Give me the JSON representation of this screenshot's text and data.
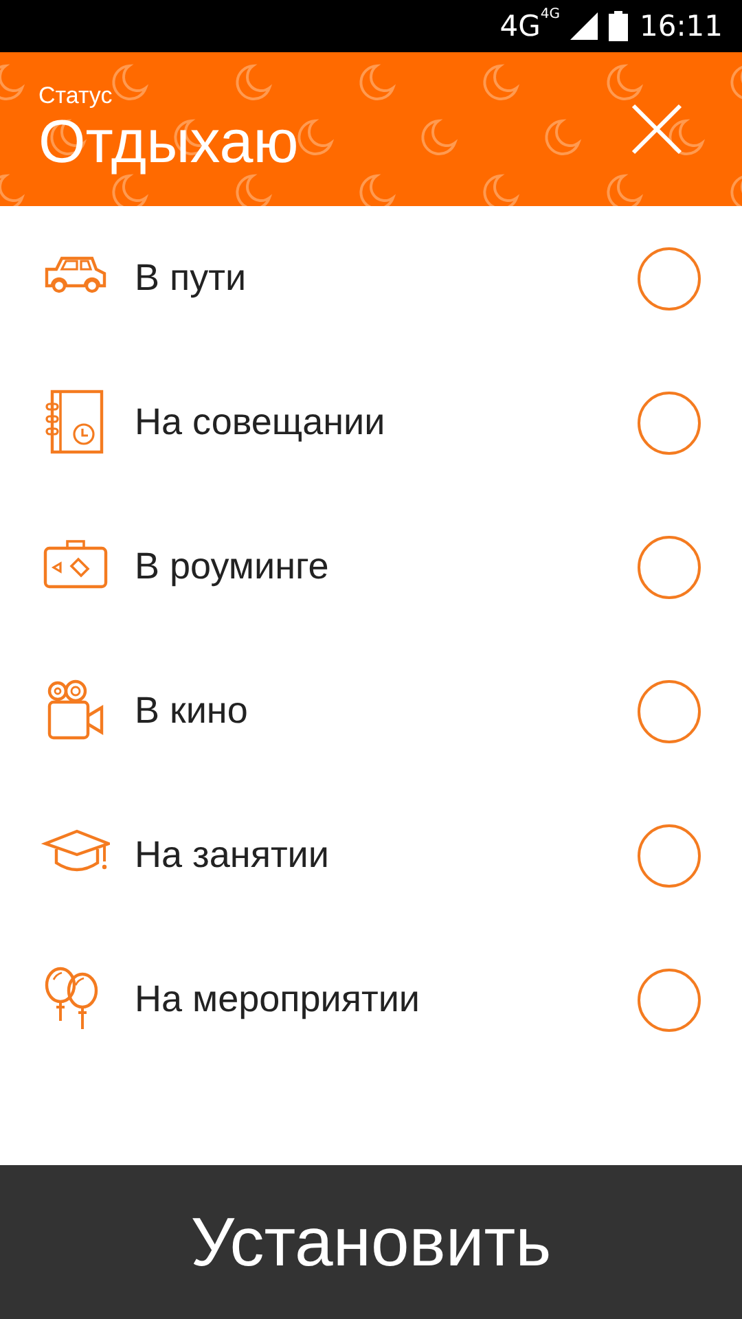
{
  "status_bar": {
    "network": "4G",
    "network_small": "4G",
    "time": "16:11"
  },
  "header": {
    "caption": "Статус",
    "title": "Отдыхаю"
  },
  "statuses": [
    {
      "kind": "car",
      "label": "В пути",
      "selected": false
    },
    {
      "kind": "notebook",
      "label": "На совещании",
      "selected": false
    },
    {
      "kind": "suitcase",
      "label": "В роуминге",
      "selected": false
    },
    {
      "kind": "camera",
      "label": "В кино",
      "selected": false
    },
    {
      "kind": "cap",
      "label": "На занятии",
      "selected": false
    },
    {
      "kind": "balloons",
      "label": "На мероприятии",
      "selected": false
    }
  ],
  "button": {
    "label": "Установить"
  }
}
